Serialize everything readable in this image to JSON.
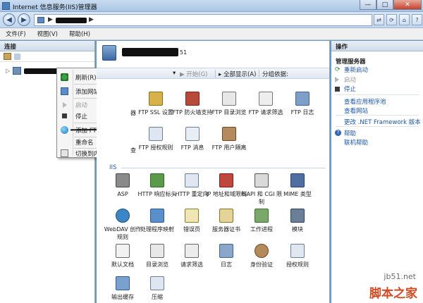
{
  "window": {
    "title": "Internet 信息服务(IIS)管理器"
  },
  "address": {
    "separator_1": "▶",
    "separator_2": "▶"
  },
  "menubar": [
    "文件(F)",
    "视图(V)",
    "帮助(H)"
  ],
  "left": {
    "header": "连接"
  },
  "context_menu": [
    {
      "label": "刷新(R)",
      "icon": "refresh-icon",
      "enabled": true
    },
    {
      "label": "添加网站...",
      "icon": "add-site-icon",
      "enabled": true
    },
    {
      "label": "启动",
      "icon": "start-icon",
      "enabled": false
    },
    {
      "label": "停止",
      "icon": "stop-icon",
      "enabled": true
    },
    {
      "label": "添加 FTP 站点...",
      "icon": "ftp-site-icon",
      "enabled": true
    },
    {
      "label": "重命名",
      "icon": "",
      "enabled": true
    },
    {
      "label": "切换到内容视图",
      "icon": "content-view-icon",
      "enabled": true
    }
  ],
  "center": {
    "server_suffix": "51",
    "filter": {
      "start": "开始(G)",
      "show_all": "全部显示(A)",
      "group_by": "分组依据:"
    },
    "ftp_section": [
      {
        "label": "FTP SSL 设置",
        "icon": "ftp-ssl-icon"
      },
      {
        "label": "FTP 防火墙支持",
        "icon": "ftp-firewall-icon"
      },
      {
        "label": "FTP 目录浏览",
        "icon": "ftp-dir-icon"
      },
      {
        "label": "FTP 请求筛选",
        "icon": "ftp-filter-icon"
      },
      {
        "label": "FTP 日志",
        "icon": "ftp-log-icon"
      },
      {
        "label": "FTP 授权规则",
        "icon": "ftp-auth-icon"
      },
      {
        "label": "FTP 消息",
        "icon": "ftp-msg-icon"
      },
      {
        "label": "FTP 用户隔离",
        "icon": "ftp-iso-icon"
      }
    ],
    "partial_labels": [
      "器",
      "查"
    ],
    "iis_label": "IIS",
    "iis_section": [
      {
        "label": "ASP",
        "icon": "asp-icon"
      },
      {
        "label": "HTTP 响应标头",
        "icon": "http-header-icon"
      },
      {
        "label": "HTTP 重定向",
        "icon": "http-redirect-icon"
      },
      {
        "label": "IP 地址和域限制",
        "icon": "ip-restrict-icon"
      },
      {
        "label": "ISAPI 和 CGI 限制",
        "icon": "isapi-icon"
      },
      {
        "label": "MIME 类型",
        "icon": "mime-icon"
      },
      {
        "label": "WebDAV 创作规则",
        "icon": "webdav-icon"
      },
      {
        "label": "处理程序映射",
        "icon": "handler-icon"
      },
      {
        "label": "错误页",
        "icon": "error-page-icon"
      },
      {
        "label": "服务器证书",
        "icon": "cert-icon"
      },
      {
        "label": "工作进程",
        "icon": "worker-icon"
      },
      {
        "label": "模块",
        "icon": "module-icon"
      },
      {
        "label": "默认文档",
        "icon": "default-doc-icon"
      },
      {
        "label": "目录浏览",
        "icon": "dir-browse-icon"
      },
      {
        "label": "请求筛选",
        "icon": "req-filter-icon"
      },
      {
        "label": "日志",
        "icon": "log-icon"
      },
      {
        "label": "身份验证",
        "icon": "auth-icon"
      },
      {
        "label": "授权规则",
        "icon": "authz-icon"
      },
      {
        "label": "输出缓存",
        "icon": "output-cache-icon"
      },
      {
        "label": "压缩",
        "icon": "compress-icon"
      }
    ]
  },
  "right": {
    "header": "操作",
    "section_title": "管理服务器",
    "items": [
      {
        "label": "重新启动",
        "enabled": true
      },
      {
        "label": "启动",
        "enabled": false
      },
      {
        "label": "停止",
        "enabled": true
      },
      {
        "label": "查看应用程序池",
        "enabled": true
      },
      {
        "label": "查看网站",
        "enabled": true
      },
      {
        "label": "更改 .NET Framework 版本",
        "enabled": true
      },
      {
        "label": "帮助",
        "enabled": true
      },
      {
        "label": "联机帮助",
        "enabled": true
      }
    ]
  },
  "watermark": {
    "site": "jb51.net",
    "brand": "脚本之家"
  }
}
